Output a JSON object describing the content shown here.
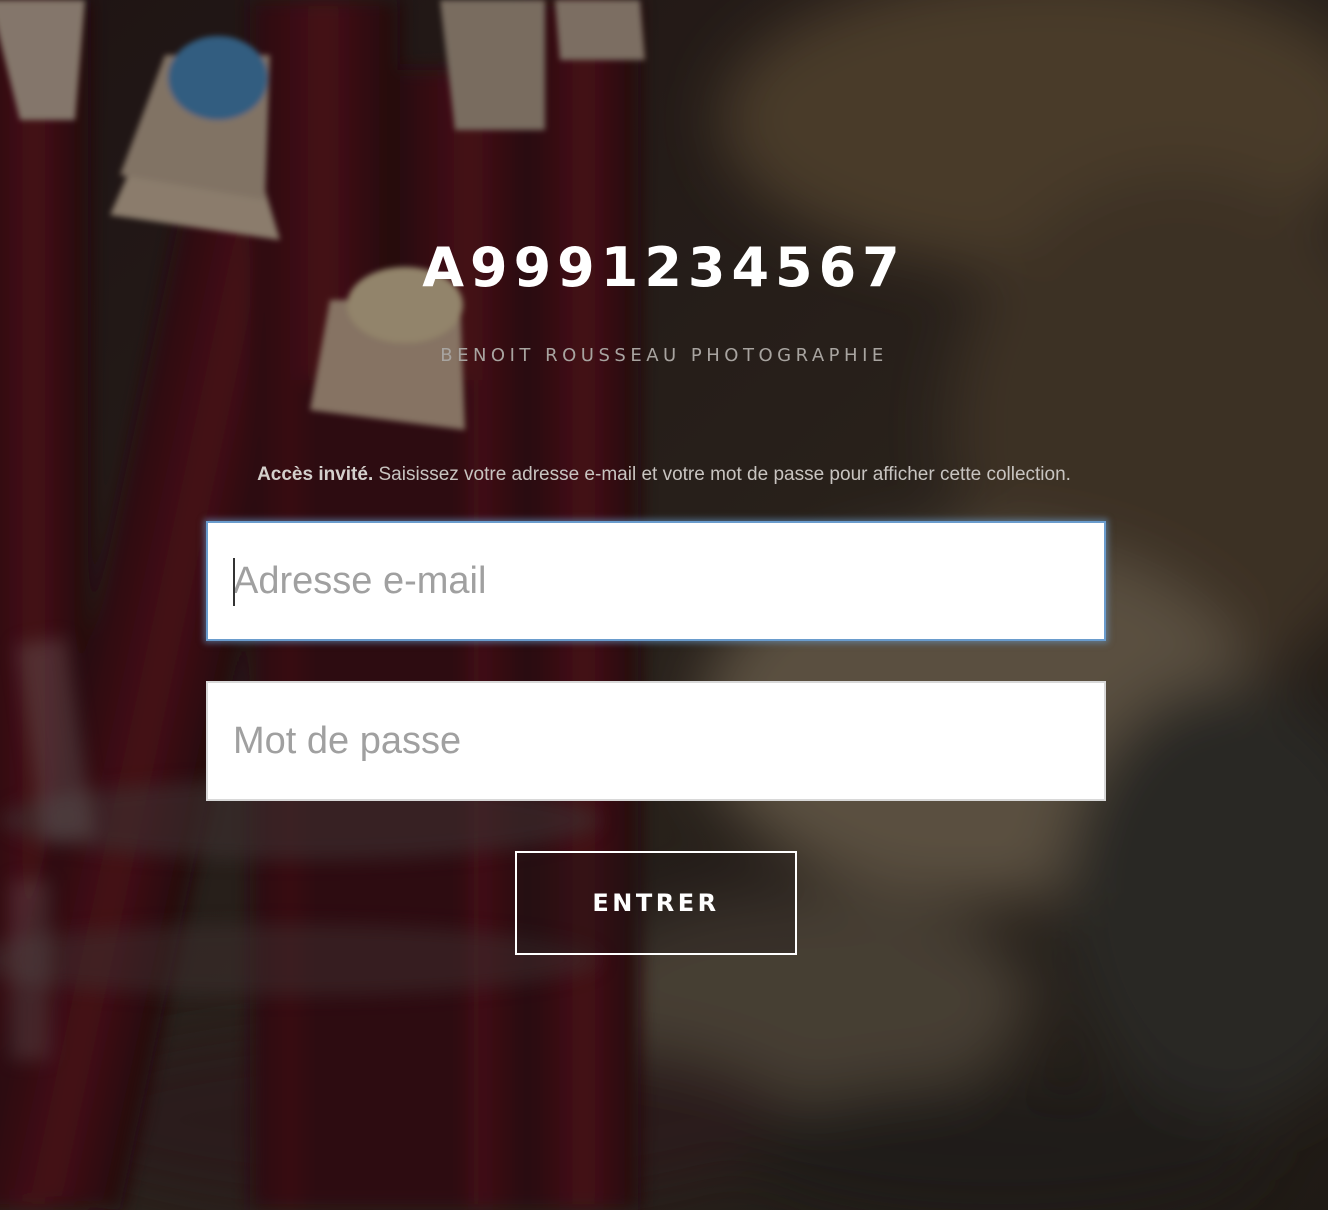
{
  "header": {
    "title": "A9991234567",
    "subtitle": "BENOIT ROUSSEAU PHOTOGRAPHIE"
  },
  "notice": {
    "bold": "Accès invité.",
    "text": " Saisissez votre adresse e-mail et votre mot de passe pour afficher cette collection."
  },
  "form": {
    "email": {
      "placeholder": "Adresse e-mail",
      "value": ""
    },
    "password": {
      "placeholder": "Mot de passe",
      "value": ""
    },
    "submit_label": "ENTRER"
  },
  "background": {
    "description_icon": "blurred-colored-pencils-photo"
  },
  "colors": {
    "focus_border": "#6a9ccd",
    "text_light": "#ffffff",
    "subtitle": "#a8a4a0"
  }
}
